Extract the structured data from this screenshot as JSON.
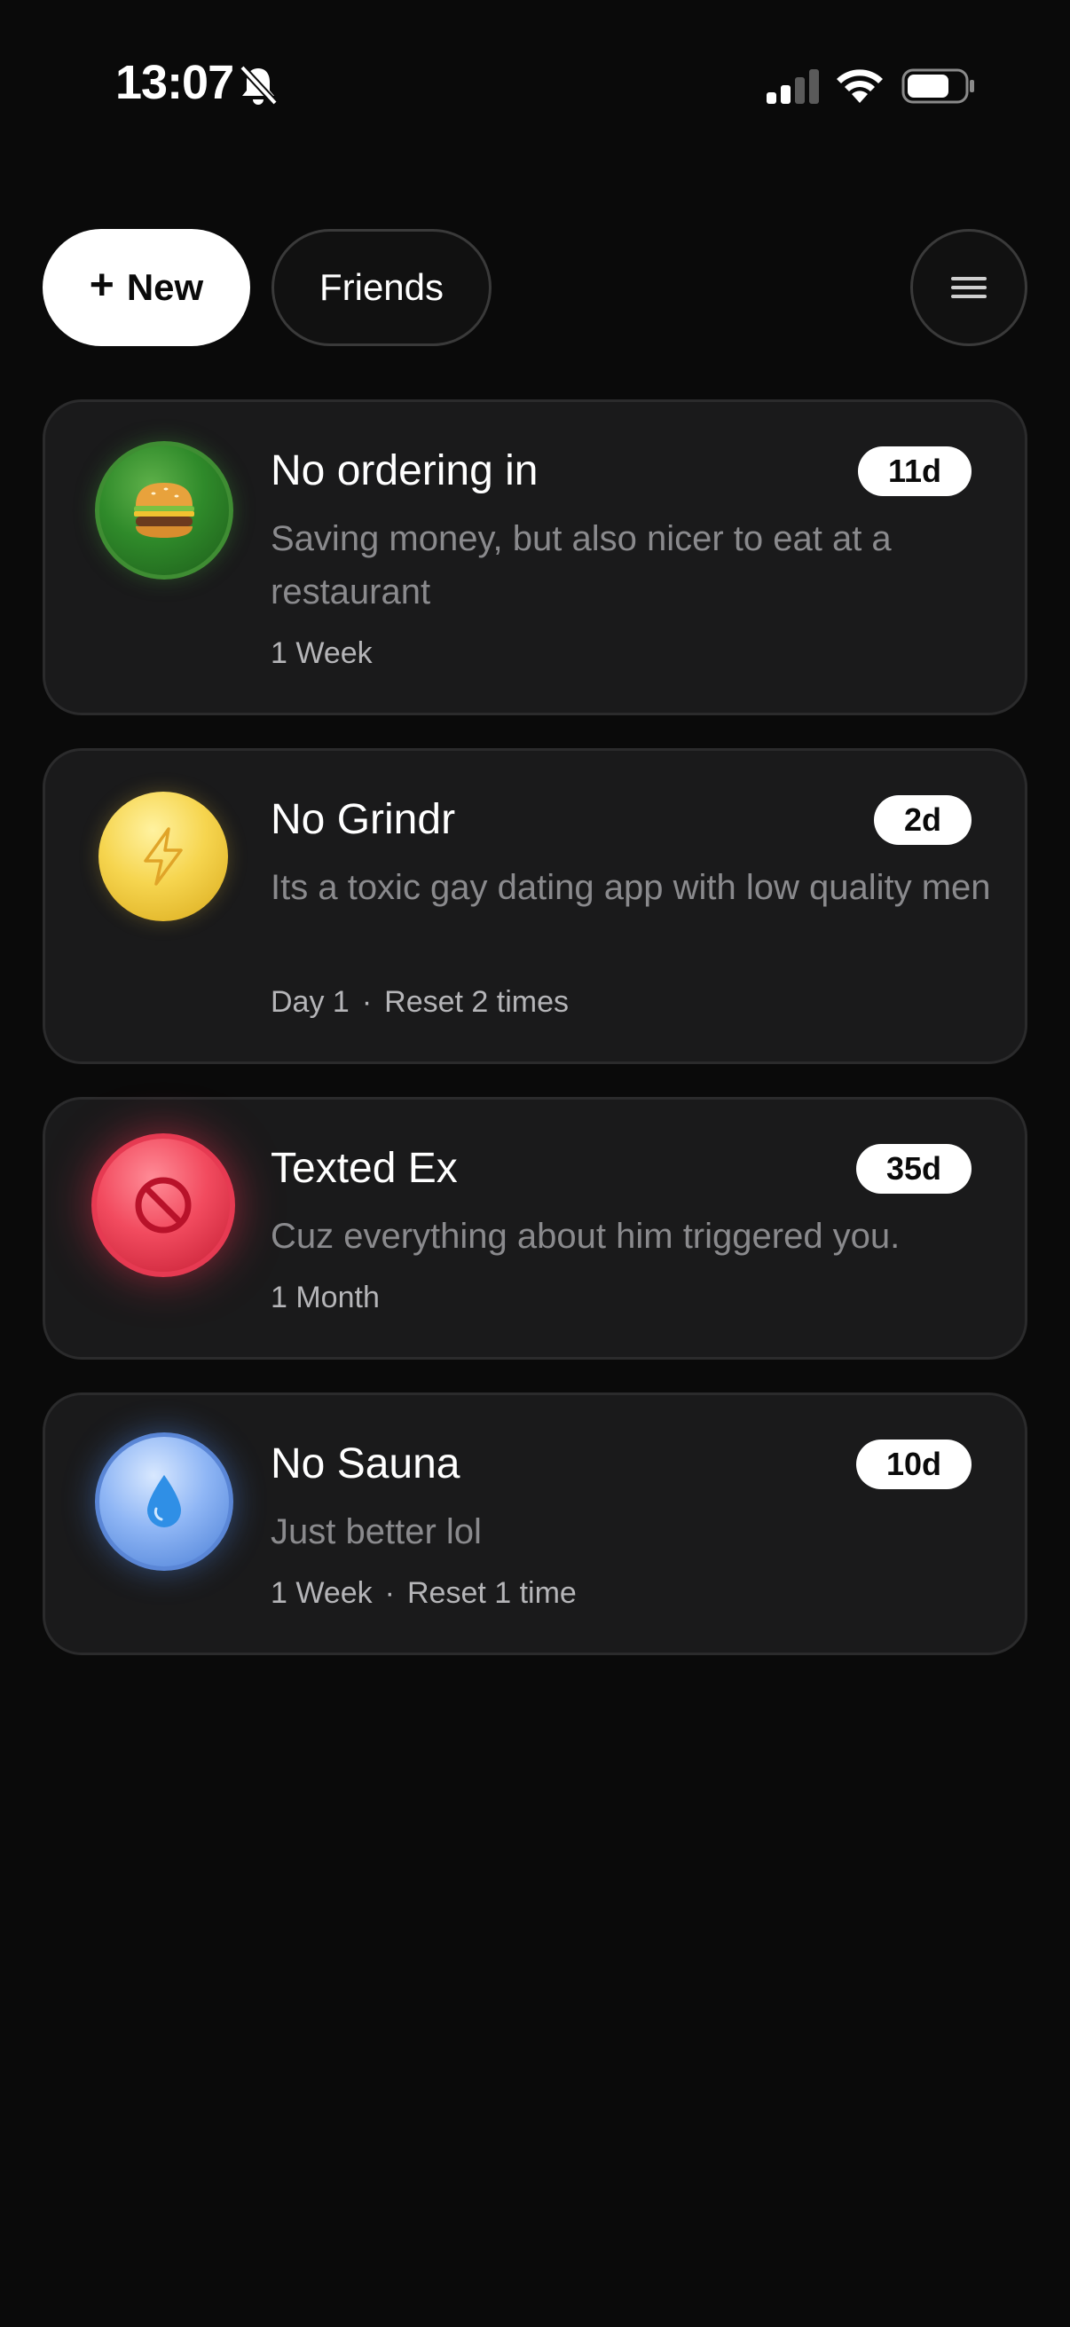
{
  "status_bar": {
    "time": "13:07",
    "icons": [
      "bell-slash-icon",
      "cellular-signal-icon",
      "wifi-icon",
      "battery-icon"
    ]
  },
  "toolbar": {
    "new_label": "New",
    "friends_label": "Friends",
    "menu_icon": "hamburger-icon"
  },
  "colors": {
    "background": "#0a0a0a",
    "card": "#1a1a1b",
    "muted_text": "#8a8a8d",
    "meta_text": "#b5b5b8"
  },
  "habits": [
    {
      "title": "No ordering in",
      "description": "Saving money, but also nicer to eat at a restaurant",
      "meta": "1 Week",
      "resets": "",
      "badge": "11d",
      "icon": "burger-icon",
      "icon_color": "#2f8a2a"
    },
    {
      "title": "No Grindr",
      "description": "Its a toxic gay dating app with low quality men",
      "meta": "Day 1",
      "resets": "Reset 2 times",
      "badge": "2d",
      "icon": "lightning-icon",
      "icon_color": "#f6d54f"
    },
    {
      "title": "Texted Ex",
      "description": "Cuz everything about him triggered you.",
      "meta": "1 Month",
      "resets": "",
      "badge": "35d",
      "icon": "prohibited-icon",
      "icon_color": "#f24b5f"
    },
    {
      "title": "No Sauna",
      "description": "Just better lol",
      "meta": "1 Week",
      "resets": "Reset 1 time",
      "badge": "10d",
      "icon": "water-drop-icon",
      "icon_color": "#8fb6f5"
    }
  ]
}
